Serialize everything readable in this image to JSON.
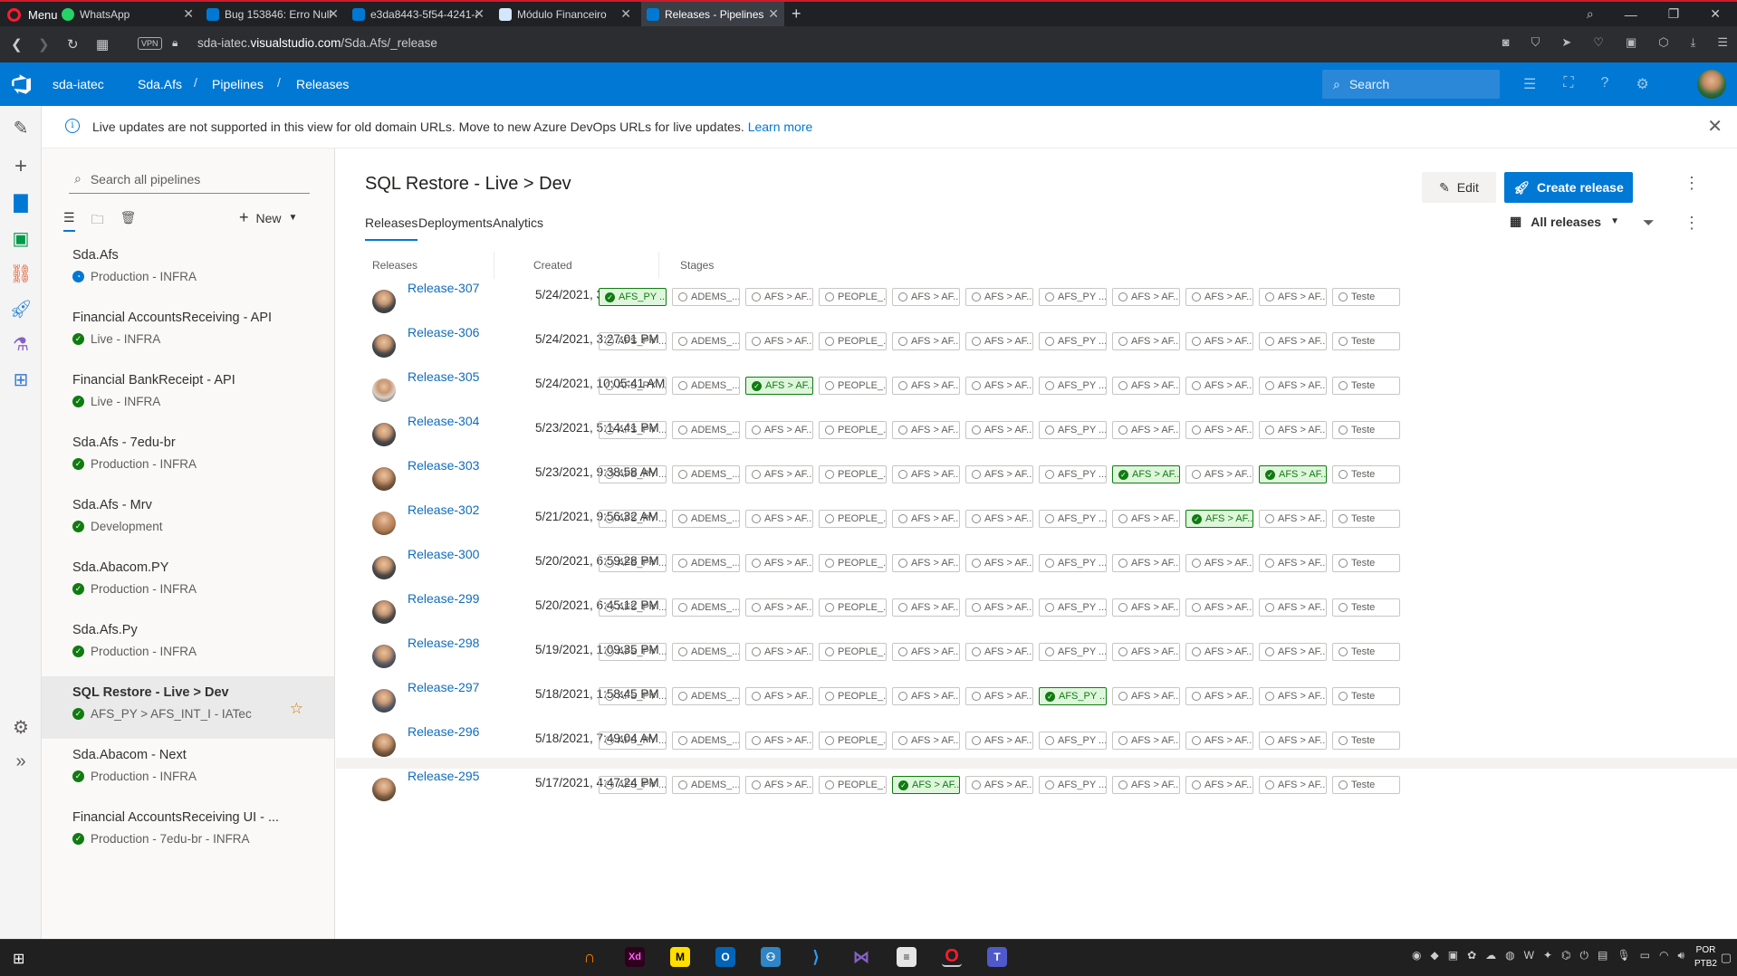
{
  "browser": {
    "menu_label": "Menu",
    "tabs": [
      {
        "label": "WhatsApp",
        "color": "#25d366"
      },
      {
        "label": "Bug 153846: Erro Null Imp",
        "color": "#0078d4"
      },
      {
        "label": "e3da8443-5f54-4241-a3e0",
        "color": "#0078d4"
      },
      {
        "label": "Módulo Financeiro",
        "color": "#d4e6fa"
      },
      {
        "label": "Releases - Pipelines",
        "color": "#0078d4"
      }
    ],
    "url_host": "sda-iatec.",
    "url_domain": "visualstudio.com",
    "url_path": "/Sda.Afs/_release",
    "vpn_label": "VPN"
  },
  "header": {
    "breadcrumb": [
      "sda-iatec",
      "Sda.Afs",
      "Pipelines",
      "Releases"
    ],
    "search_placeholder": "Search"
  },
  "banner": {
    "text": "Live updates are not supported in this view for old domain URLs. Move to new Azure DevOps URLs for live updates.",
    "link": "Learn more"
  },
  "pipelines": {
    "search_placeholder": "Search all pipelines",
    "new_label": "New",
    "items": [
      {
        "name": "Sda.Afs",
        "env": "Production - INFRA",
        "status": "in-progress"
      },
      {
        "name": "Financial AccountsReceiving - API",
        "env": "Live - INFRA",
        "status": "succeeded"
      },
      {
        "name": "Financial BankReceipt - API",
        "env": "Live - INFRA",
        "status": "succeeded"
      },
      {
        "name": "Sda.Afs - 7edu-br",
        "env": "Production - INFRA",
        "status": "succeeded"
      },
      {
        "name": "Sda.Afs - Mrv",
        "env": "Development",
        "status": "succeeded"
      },
      {
        "name": "Sda.Abacom.PY",
        "env": "Production - INFRA",
        "status": "succeeded"
      },
      {
        "name": "Sda.Afs.Py",
        "env": "Production - INFRA",
        "status": "succeeded"
      },
      {
        "name": "SQL Restore - Live > Dev",
        "env": "AFS_PY > AFS_INT_I - IATec",
        "status": "succeeded",
        "selected": true
      },
      {
        "name": "Sda.Abacom - Next",
        "env": "Production - INFRA",
        "status": "succeeded"
      },
      {
        "name": "Financial AccountsReceiving UI - ...",
        "env": "Production - 7edu-br - INFRA",
        "status": "succeeded"
      }
    ]
  },
  "main": {
    "title": "SQL Restore - Live > Dev",
    "edit_label": "Edit",
    "create_label": "Create release",
    "tabs": [
      "Releases",
      "Deployments",
      "Analytics"
    ],
    "filter_label": "All releases",
    "columns": [
      "Releases",
      "Created",
      "Stages"
    ],
    "stage_labels": [
      "AFS_PY ...",
      "ADEMS_...",
      "AFS > AF...",
      "PEOPLE_...",
      "AFS > AF...",
      "AFS > AF...",
      "AFS_PY ...",
      "AFS > AF...",
      "AFS > AF...",
      "AFS > AF...",
      "Teste"
    ],
    "releases": [
      {
        "name": "Release-307",
        "created": "5/24/2021, 3:38:37 PM",
        "succeeded_stages": [
          0
        ],
        "avatar": "#4a4a4a"
      },
      {
        "name": "Release-306",
        "created": "5/24/2021, 3:27:01 PM",
        "succeeded_stages": [],
        "avatar": "#4a4a4a"
      },
      {
        "name": "Release-305",
        "created": "5/24/2021, 10:05:41 AM",
        "succeeded_stages": [
          2
        ],
        "avatar": "#d9d0c8"
      },
      {
        "name": "Release-304",
        "created": "5/23/2021, 5:14:41 PM",
        "succeeded_stages": [],
        "avatar": "#4a4a4a"
      },
      {
        "name": "Release-303",
        "created": "5/23/2021, 9:38:58 AM",
        "succeeded_stages": [
          7,
          9
        ],
        "avatar": "#7a5a3e"
      },
      {
        "name": "Release-302",
        "created": "5/21/2021, 9:56:32 AM",
        "succeeded_stages": [
          8
        ],
        "avatar": "#b07a50"
      },
      {
        "name": "Release-300",
        "created": "5/20/2021, 6:59:28 PM",
        "succeeded_stages": [],
        "avatar": "#4a4a4a"
      },
      {
        "name": "Release-299",
        "created": "5/20/2021, 6:45:12 PM",
        "succeeded_stages": [],
        "avatar": "#4a4a4a"
      },
      {
        "name": "Release-298",
        "created": "5/19/2021, 1:09:35 PM",
        "succeeded_stages": [],
        "avatar": "#555a66"
      },
      {
        "name": "Release-297",
        "created": "5/18/2021, 1:58:45 PM",
        "succeeded_stages": [
          6
        ],
        "avatar": "#555a66"
      },
      {
        "name": "Release-296",
        "created": "5/18/2021, 7:49:04 AM",
        "succeeded_stages": [],
        "avatar": "#7a5a3e"
      },
      {
        "name": "Release-295",
        "created": "5/17/2021, 4:47:24 PM",
        "succeeded_stages": [
          4
        ],
        "avatar": "#7a5a3e"
      }
    ]
  },
  "taskbar": {
    "lang_1": "POR",
    "lang_2": "PTB2"
  },
  "colors": {
    "accent": "#0078d4",
    "success": "#107c10",
    "opera_red": "#ff1b2d"
  }
}
